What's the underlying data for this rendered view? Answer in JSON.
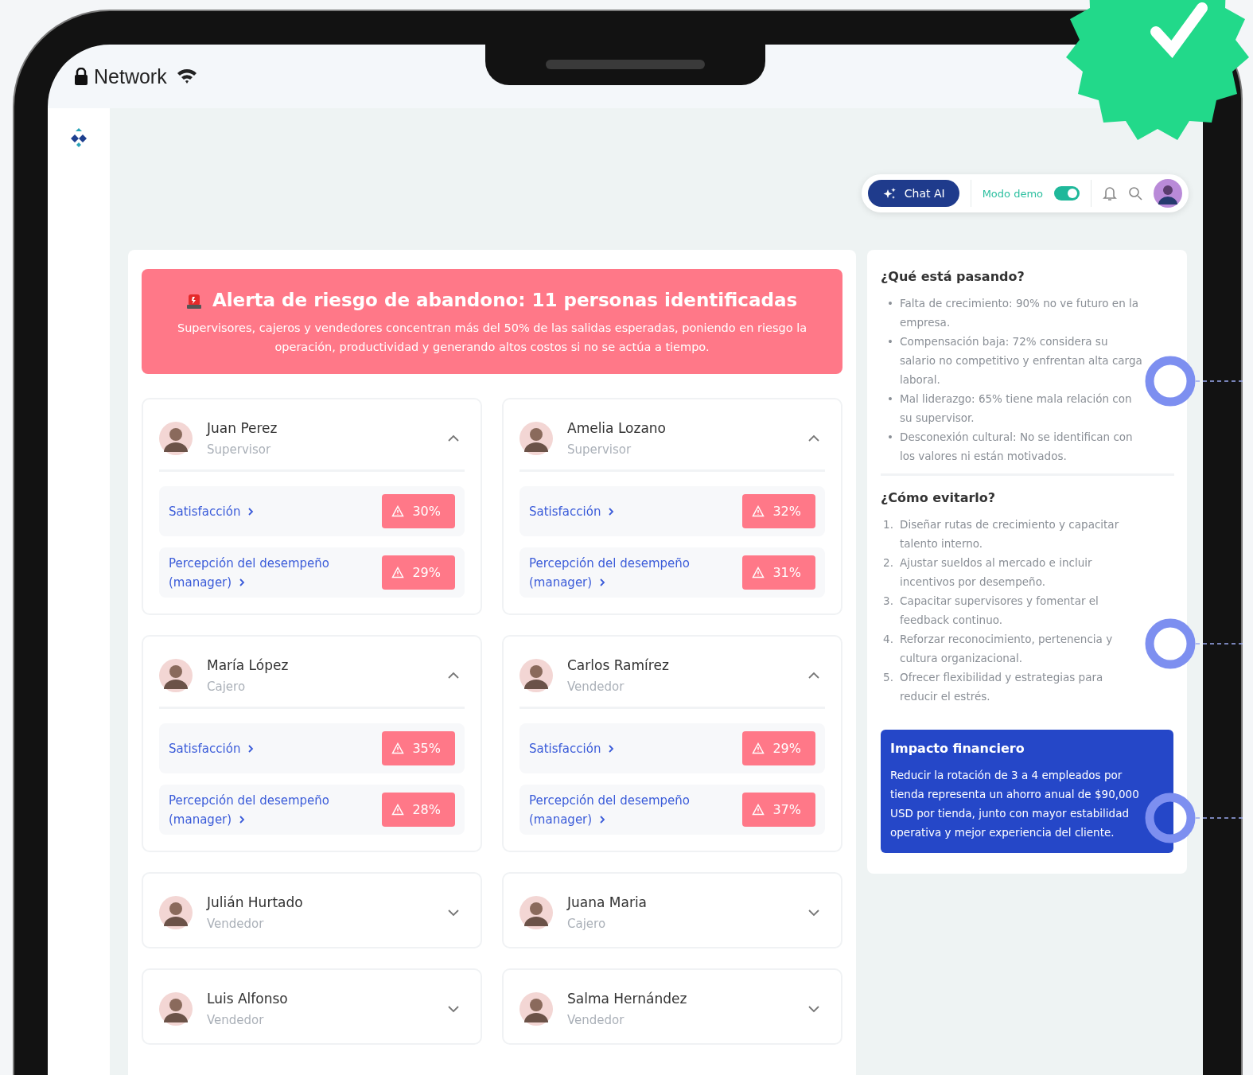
{
  "status_bar": {
    "carrier": "Network"
  },
  "toolbar": {
    "chat_button": "Chat AI",
    "demo_mode": {
      "label": "Modo demo",
      "on": true
    }
  },
  "alert": {
    "title": "Alerta de riesgo de abandono: 11 personas identificadas",
    "text": "Supervisores, cajeros y vendedores concentran más del 50% de las salidas esperadas, poniendo en riesgo la operación, productividad y generando altos costos si no se actúa a tiempo."
  },
  "people": [
    {
      "name": "Juan Perez",
      "role": "Supervisor",
      "expanded": true,
      "metrics": [
        {
          "label": "Satisfacción",
          "value": "30%"
        },
        {
          "label": "Percepción del desempeño (manager)",
          "value": "29%"
        }
      ]
    },
    {
      "name": "Amelia Lozano",
      "role": "Supervisor",
      "expanded": true,
      "metrics": [
        {
          "label": "Satisfacción",
          "value": "32%"
        },
        {
          "label": "Percepción del desempeño (manager)",
          "value": "31%"
        }
      ]
    },
    {
      "name": "María López",
      "role": "Cajero",
      "expanded": true,
      "metrics": [
        {
          "label": "Satisfacción",
          "value": "35%"
        },
        {
          "label": "Percepción del desempeño (manager)",
          "value": "28%"
        }
      ]
    },
    {
      "name": "Carlos Ramírez",
      "role": "Vendedor",
      "expanded": true,
      "metrics": [
        {
          "label": "Satisfacción",
          "value": "29%"
        },
        {
          "label": "Percepción del desempeño (manager)",
          "value": "37%"
        }
      ]
    },
    {
      "name": "Julián Hurtado",
      "role": "Vendedor",
      "expanded": false
    },
    {
      "name": "Juana Maria",
      "role": "Cajero",
      "expanded": false
    },
    {
      "name": "Luis Alfonso",
      "role": "Vendedor",
      "expanded": false
    },
    {
      "name": "Salma Hernández",
      "role": "Vendedor",
      "expanded": false
    }
  ],
  "insights": {
    "what_is_happening": {
      "title": "¿Qué está pasando?",
      "items": [
        {
          "marker": "•",
          "text": "Falta de crecimiento: 90% no ve futuro en la empresa."
        },
        {
          "marker": "•",
          "text": "Compensación baja: 72% considera su salario no competitivo y enfrentan alta carga laboral."
        },
        {
          "marker": "•",
          "text": "Mal liderazgo: 65% tiene mala relación con su supervisor."
        },
        {
          "marker": "•",
          "text": "Desconexión cultural: No se identifican con los valores ni están motivados."
        }
      ]
    },
    "how_to_avoid": {
      "title": "¿Cómo evitarlo?",
      "items": [
        {
          "marker": "1.",
          "text": "Diseñar rutas de crecimiento y capacitar talento interno."
        },
        {
          "marker": "2.",
          "text": "Ajustar sueldos al mercado e incluir incentivos por desempeño."
        },
        {
          "marker": "3.",
          "text": "Capacitar supervisores y fomentar el feedback continuo."
        },
        {
          "marker": "4.",
          "text": "Reforzar reconocimiento, pertenencia y cultura organizacional."
        },
        {
          "marker": "5.",
          "text": "Ofrecer flexibilidad y estrategias para reducir el estrés."
        }
      ]
    },
    "financial_impact": {
      "title": "Impacto financiero",
      "text": "Reducir la rotación de 3 a 4 empleados por tienda representa un ahorro anual de $90,000 USD por tienda, junto con mayor estabilidad operativa y mejor experiencia del cliente."
    }
  }
}
